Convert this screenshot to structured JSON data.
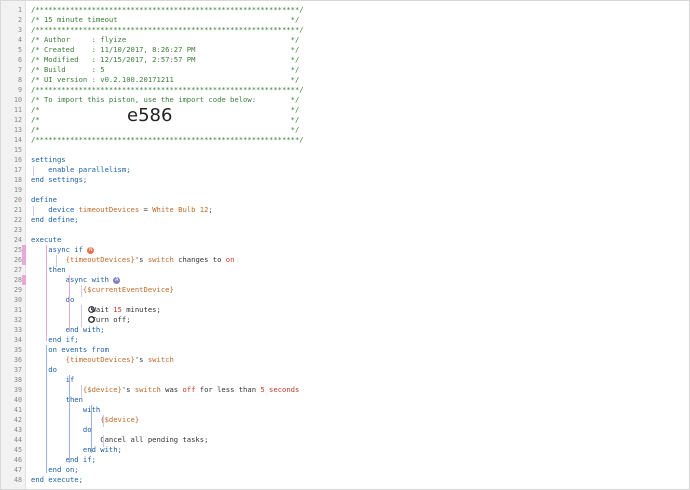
{
  "lines": [
    {
      "n": "1",
      "tokens": [
        {
          "c": "g",
          "t": "/*************************************************************/"
        }
      ]
    },
    {
      "n": "2",
      "tokens": [
        {
          "c": "g",
          "t": "/* 15 minute timeout                                        */"
        }
      ]
    },
    {
      "n": "3",
      "tokens": [
        {
          "c": "g",
          "t": "/*************************************************************/"
        }
      ]
    },
    {
      "n": "4",
      "tokens": [
        {
          "c": "g",
          "t": "/* Author     : flyize                                      */"
        }
      ]
    },
    {
      "n": "5",
      "tokens": [
        {
          "c": "g",
          "t": "/* Created    : 11/10/2017, 8:26:27 PM                      */"
        }
      ]
    },
    {
      "n": "6",
      "tokens": [
        {
          "c": "g",
          "t": "/* Modified   : 12/15/2017, 2:57:57 PM                      */"
        }
      ]
    },
    {
      "n": "7",
      "tokens": [
        {
          "c": "g",
          "t": "/* Build      : 5                                           */"
        }
      ]
    },
    {
      "n": "8",
      "tokens": [
        {
          "c": "g",
          "t": "/* UI version : v0.2.100.20171211                           */"
        }
      ]
    },
    {
      "n": "9",
      "tokens": [
        {
          "c": "g",
          "t": "/*************************************************************/"
        }
      ]
    },
    {
      "n": "10",
      "tokens": [
        {
          "c": "g",
          "t": "/* To import this piston, use the import code below:        */"
        }
      ]
    },
    {
      "n": "11",
      "tokens": [
        {
          "c": "g",
          "t": "/*                                                          */"
        }
      ]
    },
    {
      "n": "12",
      "tokens": [
        {
          "c": "g",
          "t": "/*                                                          */"
        }
      ]
    },
    {
      "n": "13",
      "tokens": [
        {
          "c": "g",
          "t": "/*                                                          */"
        }
      ]
    },
    {
      "n": "14",
      "tokens": [
        {
          "c": "g",
          "t": "/*************************************************************/"
        }
      ]
    },
    {
      "n": "15",
      "tokens": []
    },
    {
      "n": "16",
      "tokens": [
        {
          "c": "kw",
          "t": "settings"
        }
      ]
    },
    {
      "n": "17",
      "tokens": [
        {
          "c": "kw",
          "t": "    enable parallelism;"
        }
      ]
    },
    {
      "n": "18",
      "tokens": [
        {
          "c": "kw",
          "t": "end settings;"
        }
      ]
    },
    {
      "n": "19",
      "tokens": []
    },
    {
      "n": "20",
      "tokens": [
        {
          "c": "kw",
          "t": "define"
        }
      ]
    },
    {
      "n": "21",
      "tokens": [
        {
          "c": "kw",
          "t": "    device "
        },
        {
          "c": "v",
          "t": "timeoutDevices"
        },
        {
          "c": "d",
          "t": " = "
        },
        {
          "c": "v",
          "t": "White Bulb 12"
        },
        {
          "c": "d",
          "t": ";"
        }
      ]
    },
    {
      "n": "22",
      "tokens": [
        {
          "c": "kw",
          "t": "end define;"
        }
      ]
    },
    {
      "n": "23",
      "tokens": []
    },
    {
      "n": "24",
      "tokens": [
        {
          "c": "kw",
          "t": "execute"
        }
      ]
    },
    {
      "n": "25",
      "tokens": [
        {
          "c": "kw",
          "t": "    async if "
        }
      ]
    },
    {
      "n": "26",
      "tokens": [
        {
          "c": "v",
          "t": "        {timeoutDevices}"
        },
        {
          "c": "d",
          "t": "'s "
        },
        {
          "c": "v",
          "t": "switch"
        },
        {
          "c": "d",
          "t": " changes to "
        },
        {
          "c": "o",
          "t": "on"
        }
      ]
    },
    {
      "n": "27",
      "tokens": [
        {
          "c": "kw",
          "t": "    then"
        }
      ]
    },
    {
      "n": "28",
      "tokens": [
        {
          "c": "kw",
          "t": "        async with "
        }
      ]
    },
    {
      "n": "29",
      "tokens": [
        {
          "c": "v",
          "t": "            {$currentEventDevice}"
        }
      ]
    },
    {
      "n": "30",
      "tokens": [
        {
          "c": "kw",
          "t": "        do"
        }
      ]
    },
    {
      "n": "31",
      "tokens": [
        {
          "c": "d",
          "t": "              Wait "
        },
        {
          "c": "o",
          "t": "15"
        },
        {
          "c": "d",
          "t": " minutes;"
        }
      ]
    },
    {
      "n": "32",
      "tokens": [
        {
          "c": "d",
          "t": "              Turn off;"
        }
      ]
    },
    {
      "n": "33",
      "tokens": [
        {
          "c": "kw",
          "t": "        end with;"
        }
      ]
    },
    {
      "n": "34",
      "tokens": [
        {
          "c": "kw",
          "t": "    end if;"
        }
      ]
    },
    {
      "n": "35",
      "tokens": [
        {
          "c": "kw",
          "t": "    on events from"
        }
      ]
    },
    {
      "n": "36",
      "tokens": [
        {
          "c": "v",
          "t": "        {timeoutDevices}"
        },
        {
          "c": "d",
          "t": "'s "
        },
        {
          "c": "v",
          "t": "switch"
        }
      ]
    },
    {
      "n": "37",
      "tokens": [
        {
          "c": "kw",
          "t": "    do"
        }
      ]
    },
    {
      "n": "38",
      "tokens": [
        {
          "c": "kw",
          "t": "        if"
        }
      ]
    },
    {
      "n": "39",
      "tokens": [
        {
          "c": "v",
          "t": "            {$device}"
        },
        {
          "c": "d",
          "t": "'s "
        },
        {
          "c": "v",
          "t": "switch"
        },
        {
          "c": "d",
          "t": " was "
        },
        {
          "c": "o",
          "t": "off"
        },
        {
          "c": "d",
          "t": " for less than "
        },
        {
          "c": "o",
          "t": "5 seconds"
        }
      ]
    },
    {
      "n": "40",
      "tokens": [
        {
          "c": "kw",
          "t": "        then"
        }
      ]
    },
    {
      "n": "41",
      "tokens": [
        {
          "c": "kw",
          "t": "            with"
        }
      ]
    },
    {
      "n": "42",
      "tokens": [
        {
          "c": "v",
          "t": "                {$device}"
        }
      ]
    },
    {
      "n": "43",
      "tokens": [
        {
          "c": "kw",
          "t": "            do"
        }
      ]
    },
    {
      "n": "44",
      "tokens": [
        {
          "c": "d",
          "t": "                Cancel all pending tasks;"
        }
      ]
    },
    {
      "n": "45",
      "tokens": [
        {
          "c": "kw",
          "t": "            end with;"
        }
      ]
    },
    {
      "n": "46",
      "tokens": [
        {
          "c": "kw",
          "t": "        end if;"
        }
      ]
    },
    {
      "n": "47",
      "tokens": [
        {
          "c": "kw",
          "t": "    end on;"
        }
      ]
    },
    {
      "n": "48",
      "tokens": [
        {
          "c": "kw",
          "t": "end execute;"
        }
      ]
    }
  ],
  "import_code": "e586",
  "badges": {
    "async_if": {
      "label": "N",
      "color": "#e07050"
    },
    "async_with": {
      "label": "A",
      "color": "#8080c0"
    }
  },
  "gutter_marks": {
    "25": "#e8a8d8",
    "26": "#e8a8d8",
    "28": "#e8a8d8"
  },
  "colors": {
    "comment": "#3a7d3a",
    "keyword": "#1a5fa8",
    "variable": "#c06a2a",
    "literal": "#c0392b"
  }
}
